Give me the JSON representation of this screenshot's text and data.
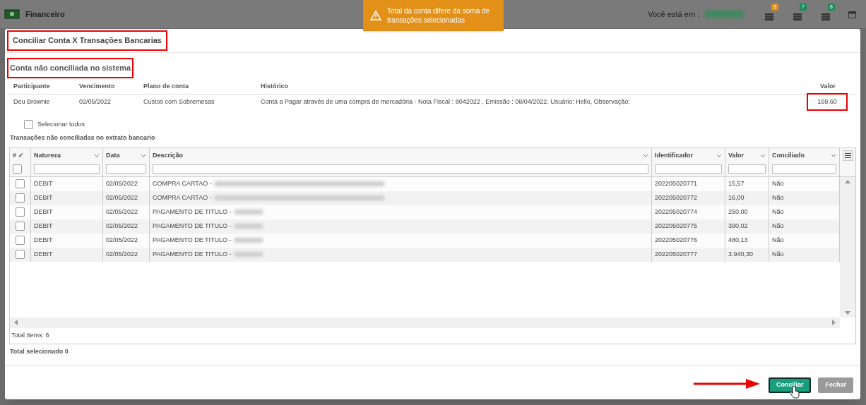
{
  "app_bar": {
    "title": "Financeiro",
    "location_label": "Você está em :",
    "badges": [
      {
        "count": "3",
        "color": "#e08e1b"
      },
      {
        "count": "7",
        "color": "#1e8a5a"
      },
      {
        "count": "8",
        "color": "#1e8a5a"
      }
    ]
  },
  "toast": {
    "message": "Total da conta difere da soma de transações selecionadas"
  },
  "dialog": {
    "title": "Conciliar Conta X Transações Bancarias",
    "account_section": {
      "heading": "Conta não conciliada no sistema",
      "columns": [
        "Participante",
        "Vencimento",
        "Plano de conta",
        "Histórico",
        "Valor"
      ],
      "row": [
        "Deu Brownie",
        "02/05/2022",
        "Custos com Sobremesas",
        "Conta a Pagar através de uma compra de mercadória - Nota Fiscal : 8042022 , Emissão : 08/04/2022, Usuário: Hello, Observação:",
        "168,60"
      ]
    },
    "select_all": {
      "label": "Selecionar todos",
      "checked": false
    },
    "transactions_heading": "Transações não conciliadas no extrato bancario",
    "grid": {
      "select_header": {
        "label": "# ✓",
        "checked": false
      },
      "columns": [
        "Natureza",
        "Data",
        "Descrição",
        "Identificador",
        "Valor",
        "Conciliado"
      ],
      "rows": [
        {
          "checked": false,
          "cells": [
            "DEBIT",
            "02/05/2022",
            "COMPRA CARTAO -",
            "202205020771",
            "15,57",
            "Não"
          ]
        },
        {
          "checked": false,
          "cells": [
            "DEBIT",
            "02/05/2022",
            "COMPRA CARTAO -",
            "202205020772",
            "16,00",
            "Não"
          ]
        },
        {
          "checked": false,
          "cells": [
            "DEBIT",
            "02/05/2022",
            "PAGAMENTO DE TITULO -",
            "202205020774",
            "250,00",
            "Não"
          ]
        },
        {
          "checked": false,
          "cells": [
            "DEBIT",
            "02/05/2022",
            "PAGAMENTO DE TITULO -",
            "202205020775",
            "390,02",
            "Não"
          ]
        },
        {
          "checked": false,
          "cells": [
            "DEBIT",
            "02/05/2022",
            "PAGAMENTO DE TITULO -",
            "202205020776",
            "480,13",
            "Não"
          ]
        },
        {
          "checked": false,
          "cells": [
            "DEBIT",
            "02/05/2022",
            "PAGAMENTO DE TITULO -",
            "202205020777",
            "3.940,30",
            "Não"
          ]
        }
      ],
      "footer": "Total Items: 6"
    },
    "total_selected": "Total selecionado 0",
    "buttons": [
      {
        "label": "Conciliar",
        "kind": "primary",
        "disabled": false
      },
      {
        "label": "Fechar",
        "kind": "secondary",
        "disabled": true
      }
    ]
  }
}
